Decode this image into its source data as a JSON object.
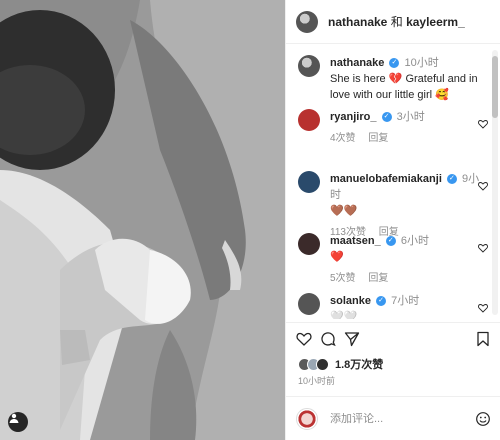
{
  "header": {
    "user1": "nathanake",
    "separator": "和",
    "user2": "kayleerm_"
  },
  "caption": {
    "username": "nathanake",
    "verified_mark": "✓",
    "time": "10小时",
    "text": "She is here 💔 Grateful and in love with our little girl 🥰"
  },
  "comments": [
    {
      "username": "ryanjiro_",
      "time": "3小时",
      "text": "",
      "likes": "4次赞",
      "reply": "回复",
      "avatar_color": "#b8312f"
    },
    {
      "username": "manuelobafemiakanji",
      "time": "9小时",
      "text": "🤎🤎",
      "likes": "113次赞",
      "reply": "回复",
      "avatar_color": "#2a4a6b"
    },
    {
      "username": "maatsen_",
      "time": "6小时",
      "text": "❤️",
      "likes": "5次赞",
      "reply": "回复",
      "avatar_color": "#3b2a2a"
    },
    {
      "username": "solanke",
      "time": "7小时",
      "text": "🤍🤍",
      "likes": "",
      "reply": "",
      "avatar_color": "#555555"
    }
  ],
  "likes": {
    "count": "1.8万次赞"
  },
  "posted": "10小时前",
  "composer": {
    "placeholder": "添加评论..."
  },
  "icons": {
    "like": "heart-icon",
    "comment": "comment-icon",
    "share": "share-icon",
    "save": "bookmark-icon",
    "emoji": "emoji-icon",
    "tag": "user-tag-icon"
  },
  "colors": {
    "verified": "#3897f0",
    "secondary_text": "#8e8e8e",
    "primary_text": "#262626"
  }
}
